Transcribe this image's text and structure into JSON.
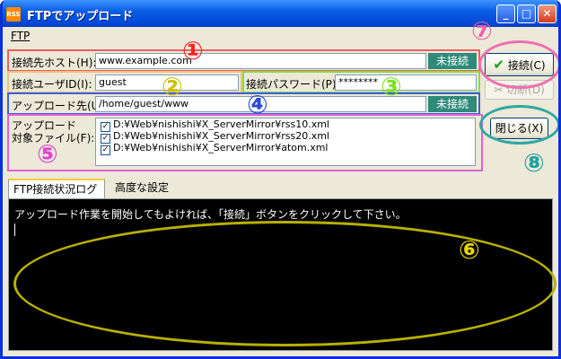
{
  "window": {
    "title": "FTPでアップロード",
    "app_icon_text": "RSS"
  },
  "menu": {
    "items": [
      "FTP"
    ]
  },
  "form": {
    "host_label": "接続先ホスト(H):",
    "host_value": "www.example.com",
    "host_status": "未接続",
    "user_label": "接続ユーザID(I):",
    "user_value": "guest",
    "password_label": "接続パスワード(P):",
    "password_value": "********",
    "upload_dir_label": "アップロード先(U):",
    "upload_dir_value": "/home/guest/www",
    "upload_dir_status": "未接続",
    "files_label_line1": "アップロード",
    "files_label_line2": "対象ファイル(F):",
    "files": [
      "D:¥Web¥nishishi¥X_ServerMirror¥rss10.xml",
      "D:¥Web¥nishishi¥X_ServerMirror¥rss20.xml",
      "D:¥Web¥nishishi¥X_ServerMirror¥atom.xml"
    ]
  },
  "buttons": {
    "connect": "接続(C)",
    "disconnect": "切断(D)",
    "close": "閉じる(X)"
  },
  "tabs": [
    "FTP接続状況ログ",
    "高度な設定"
  ],
  "log": {
    "message": "アップロード作業を開始してもよければ、「接続」ボタンをクリックして下さい。"
  },
  "annotations": {
    "n1": "①",
    "n2": "②",
    "n3": "③",
    "n4": "④",
    "n5": "⑤",
    "n6": "⑥",
    "n7": "⑦",
    "n8": "⑧"
  },
  "colors": {
    "title_blue": "#0046d5",
    "status_teal": "#2f8a7a",
    "ann_red": "#ff2020",
    "ann_olive": "#c8c000",
    "ann_green": "#7de020",
    "ann_blue": "#2a4ad8",
    "ann_magenta": "#e040d0",
    "ann_yellow": "#f0e010",
    "ann_pink": "#f080c0",
    "ann_teal": "#20a0a0"
  }
}
